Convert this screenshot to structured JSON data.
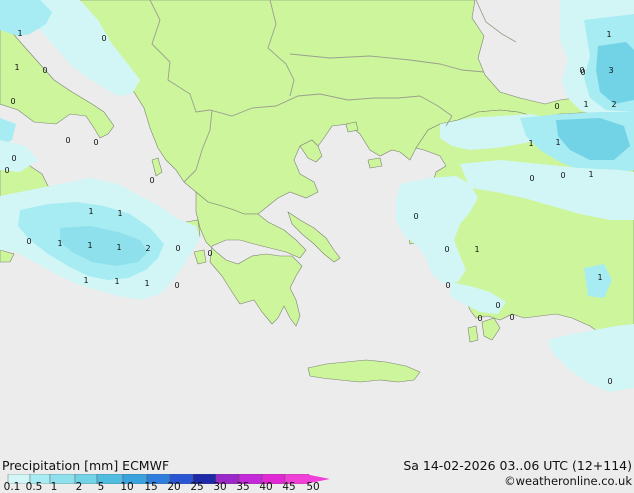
{
  "title_left": "Precipitation [mm]  ECMWF",
  "title_right": "Sa 14-02-2026 03..06 UTC (12+114)",
  "copyright": "©weatheronline.co.uk",
  "legend": {
    "ticks": [
      "0.1",
      "0.5",
      "1",
      "2",
      "5",
      "10",
      "15",
      "20",
      "25",
      "30",
      "35",
      "40",
      "45",
      "50"
    ],
    "colors": [
      "#d2f6f6",
      "#a6ecf2",
      "#8ee0ec",
      "#72d2e6",
      "#50bce0",
      "#3aa2dc",
      "#2f7ede",
      "#2a56d4",
      "#1f2aa8",
      "#9b28c8",
      "#c428d8",
      "#e028d4",
      "#f040d8"
    ]
  },
  "colors": {
    "sea": "#ececec",
    "land": "#ccf59c",
    "border": "#9aa08e",
    "coast": "#7d8374"
  },
  "map_values": [
    {
      "text": "1"
    },
    {
      "text": "0"
    },
    {
      "text": "1"
    },
    {
      "text": "0"
    },
    {
      "text": "0"
    },
    {
      "text": "0"
    },
    {
      "text": "0"
    },
    {
      "text": "0"
    },
    {
      "text": "0"
    },
    {
      "text": "0"
    },
    {
      "text": "1"
    },
    {
      "text": "1"
    },
    {
      "text": "0"
    },
    {
      "text": "1"
    },
    {
      "text": "1"
    },
    {
      "text": "1"
    },
    {
      "text": "2"
    },
    {
      "text": "0"
    },
    {
      "text": "1"
    },
    {
      "text": "1"
    },
    {
      "text": "1"
    },
    {
      "text": "0"
    },
    {
      "text": "0"
    },
    {
      "text": "0"
    },
    {
      "text": "0"
    },
    {
      "text": "1"
    },
    {
      "text": "0"
    },
    {
      "text": "0"
    },
    {
      "text": "0"
    },
    {
      "text": "0"
    },
    {
      "text": "0"
    },
    {
      "text": "1"
    },
    {
      "text": "0"
    },
    {
      "text": "3"
    },
    {
      "text": "1"
    },
    {
      "text": "0"
    },
    {
      "text": "1"
    },
    {
      "text": "2"
    },
    {
      "text": "1"
    },
    {
      "text": "1"
    },
    {
      "text": "0"
    },
    {
      "text": "0"
    },
    {
      "text": "1"
    },
    {
      "text": "0"
    }
  ]
}
